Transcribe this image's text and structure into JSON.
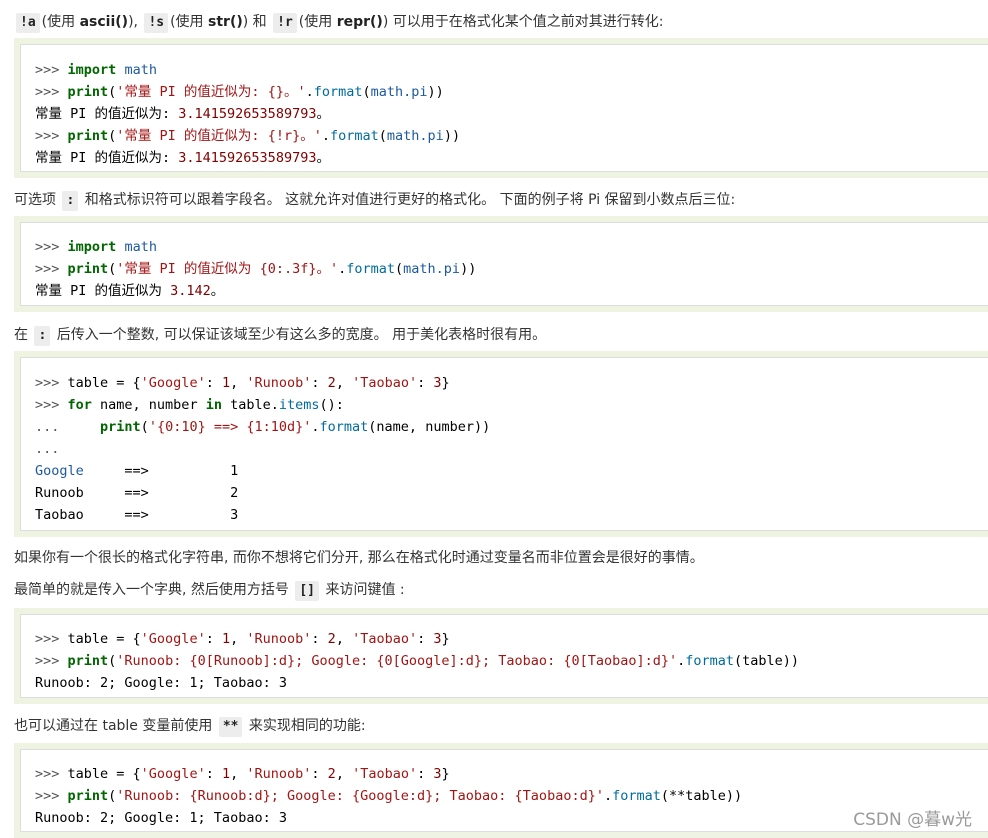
{
  "paragraphs": {
    "p1": {
      "code_a": "!a",
      "t1": "(使用 ",
      "b_ascii": "ascii()",
      "t2": "), ",
      "code_s": "!s",
      "t3": "(使用 ",
      "b_str": "str()",
      "t4": ") 和 ",
      "code_r": "!r",
      "t5": "(使用 ",
      "b_repr": "repr()",
      "t6": ") 可以用于在格式化某个值之前对其进行转化:"
    },
    "p2": {
      "t1": "可选项 ",
      "code_colon": ":",
      "t2": " 和格式标识符可以跟着字段名。 这就允许对值进行更好的格式化。 下面的例子将 Pi 保留到小数点后三位:"
    },
    "p3": {
      "t1": "在 ",
      "code_colon": ":",
      "t2": " 后传入一个整数, 可以保证该域至少有这么多的宽度。 用于美化表格时很有用。"
    },
    "p4": {
      "t1": "如果你有一个很长的格式化字符串, 而你不想将它们分开, 那么在格式化时通过变量名而非位置会是很好的事情。"
    },
    "p5": {
      "t1": "最简单的就是传入一个字典, 然后使用方括号 ",
      "code_brackets": "[]",
      "t2": " 来访问键值 :"
    },
    "p6": {
      "t1": "也可以通过在 table 变量前使用 ",
      "code_stars": "**",
      "t2": " 来实现相同的功能:"
    }
  },
  "code1": {
    "l1": {
      "prompt": ">>> ",
      "kw": "import",
      "sp": " ",
      "mod": "math"
    },
    "l2": {
      "prompt": ">>> ",
      "kw": "print",
      "open": "(",
      "str": "'常量 PI 的值近似为: {}。'",
      "dot": ".",
      "fn": "format",
      "open2": "(",
      "arg": "math.pi",
      "close": "))"
    },
    "l3": {
      "text": "常量 PI 的值近似为: ",
      "num": "3.141592653589793",
      "end": "。"
    },
    "l4": {
      "prompt": ">>> ",
      "kw": "print",
      "open": "(",
      "str": "'常量 PI 的值近似为: {!r}。'",
      "dot": ".",
      "fn": "format",
      "open2": "(",
      "arg": "math.pi",
      "close": "))"
    },
    "l5": {
      "text": "常量 PI 的值近似为: ",
      "num": "3.141592653589793",
      "end": "。"
    }
  },
  "code2": {
    "l1": {
      "prompt": ">>> ",
      "kw": "import",
      "sp": " ",
      "mod": "math"
    },
    "l2": {
      "prompt": ">>> ",
      "kw": "print",
      "open": "(",
      "str": "'常量 PI 的值近似为 {0:.3f}。'",
      "dot": ".",
      "fn": "format",
      "open2": "(",
      "arg": "math.pi",
      "close": "))"
    },
    "l3": {
      "text": "常量 PI 的值近似为 ",
      "num": "3.142",
      "end": "。"
    }
  },
  "code3": {
    "l1": {
      "prompt": ">>> ",
      "t1": "table = {",
      "s1": "'Google'",
      "t2": ": ",
      "n1": "1",
      "t3": ", ",
      "s2": "'Runoob'",
      "t4": ": ",
      "n2": "2",
      "t5": ", ",
      "s3": "'Taobao'",
      "t6": ": ",
      "n3": "3",
      "t7": "}"
    },
    "l2": {
      "prompt": ">>> ",
      "kw1": "for",
      "t1": " name, number ",
      "kw2": "in",
      "t2": " table.",
      "fn": "items",
      "t3": "():"
    },
    "l3": {
      "prompt": "...     ",
      "kw": "print",
      "open": "(",
      "str": "'{0:10} ==> {1:10d}'",
      "dot": ".",
      "fn": "format",
      "args": "(name, number))"
    },
    "l4": {
      "prompt": "..."
    },
    "l5": {
      "name": "Google",
      "arrow": "     ==>          ",
      "num": "1"
    },
    "l6": {
      "name": "Runoob",
      "arrow": "     ==>          ",
      "num": "2"
    },
    "l7": {
      "name": "Taobao",
      "arrow": "     ==>          ",
      "num": "3"
    }
  },
  "code4": {
    "l1": {
      "prompt": ">>> ",
      "t1": "table = {",
      "s1": "'Google'",
      "t2": ": ",
      "n1": "1",
      "t3": ", ",
      "s2": "'Runoob'",
      "t4": ": ",
      "n2": "2",
      "t5": ", ",
      "s3": "'Taobao'",
      "t6": ": ",
      "n3": "3",
      "t7": "}"
    },
    "l2": {
      "prompt": ">>> ",
      "kw": "print",
      "open": "(",
      "str": "'Runoob: {0[Runoob]:d}; Google: {0[Google]:d}; Taobao: {0[Taobao]:d}'",
      "dot": ".",
      "fn": "format",
      "args": "(table))"
    },
    "l3": {
      "text": "Runoob: 2; Google: 1; Taobao: 3"
    }
  },
  "code5": {
    "l1": {
      "prompt": ">>> ",
      "t1": "table = {",
      "s1": "'Google'",
      "t2": ": ",
      "n1": "1",
      "t3": ", ",
      "s2": "'Runoob'",
      "t4": ": ",
      "n2": "2",
      "t5": ", ",
      "s3": "'Taobao'",
      "t6": ": ",
      "n3": "3",
      "t7": "}"
    },
    "l2": {
      "prompt": ">>> ",
      "kw": "print",
      "open": "(",
      "str": "'Runoob: {Runoob:d}; Google: {Google:d}; Taobao: {Taobao:d}'",
      "dot": ".",
      "fn": "format",
      "args": "(**table))"
    },
    "l3": {
      "text": "Runoob: 2; Google: 1; Taobao: 3"
    }
  },
  "watermark": "CSDN @暮w光"
}
